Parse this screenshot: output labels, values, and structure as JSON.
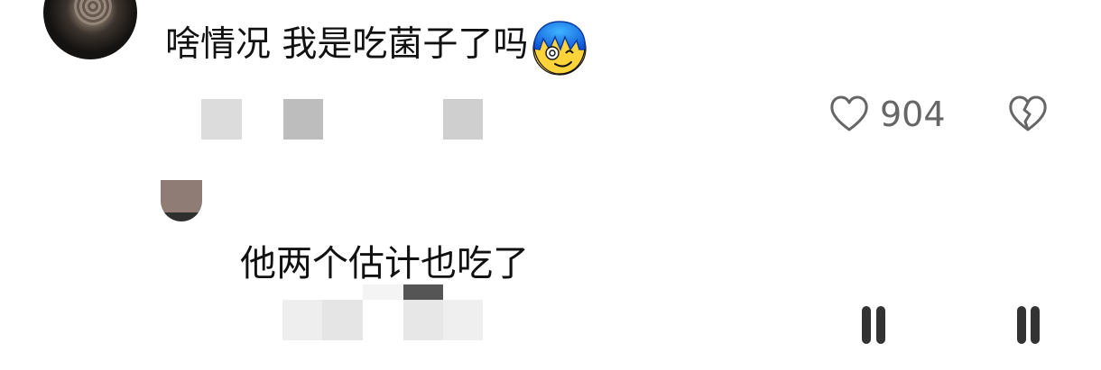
{
  "comment": {
    "text": "啥情况 我是吃菌子了吗",
    "emoji_icon": "dizzy-face-icon",
    "likes": "904"
  },
  "reply": {
    "text": "他两个估计也吃了"
  },
  "icons": {
    "like": "heart-outline-icon",
    "dislike": "broken-heart-outline-icon"
  },
  "colors": {
    "background": "#ffffff",
    "text": "#111111",
    "secondary_text": "#666666",
    "emoji_blue": "#1f86ff",
    "emoji_yellow": "#ffd43b"
  }
}
